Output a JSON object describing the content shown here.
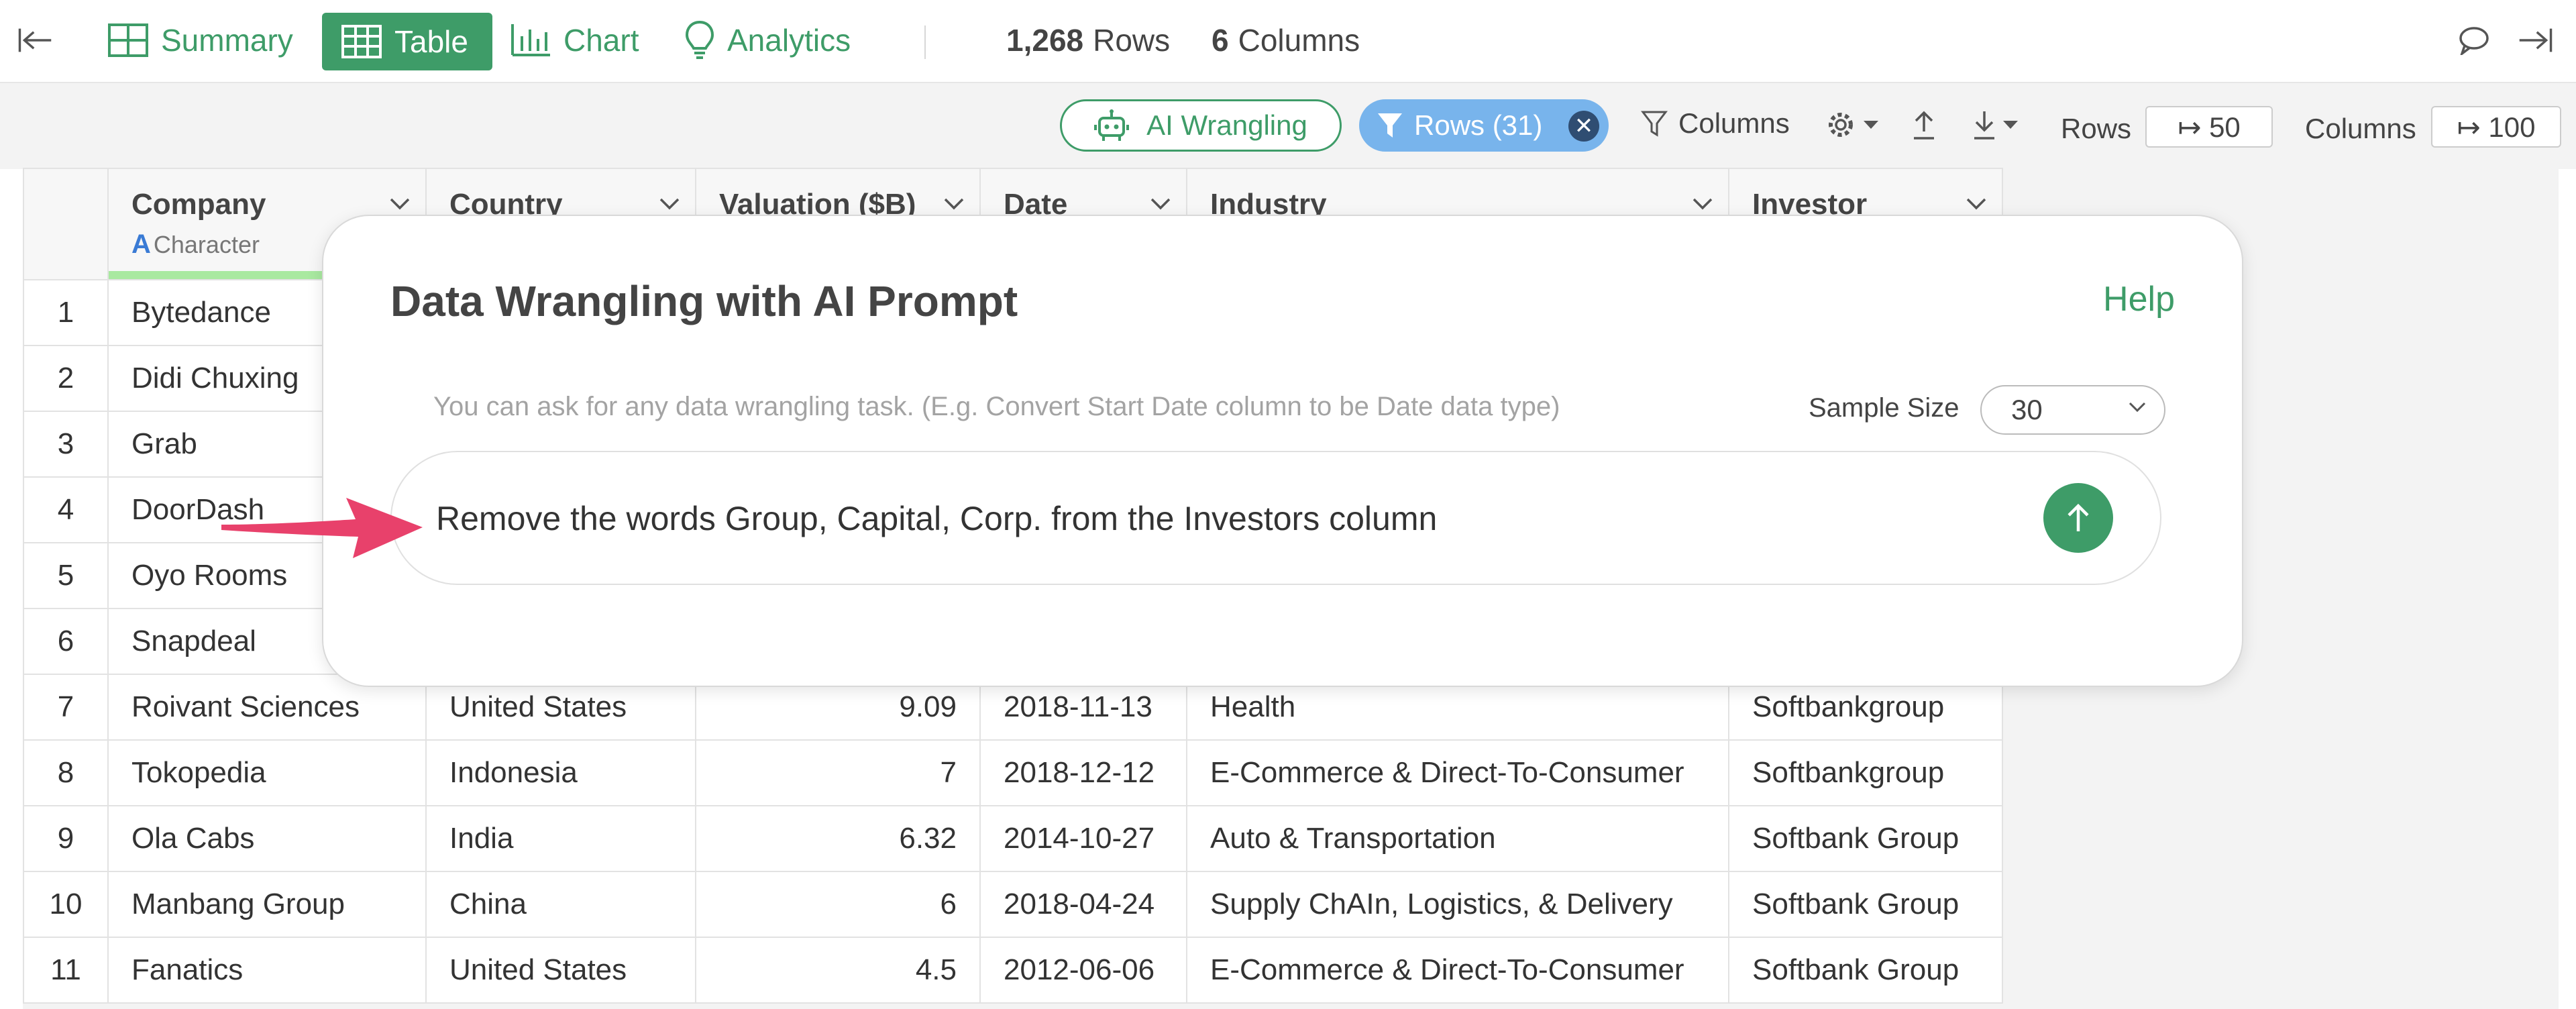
{
  "topbar": {
    "tabs": [
      {
        "label": "Summary",
        "icon": "summary-grid-icon"
      },
      {
        "label": "Table",
        "icon": "table-icon",
        "active": true
      },
      {
        "label": "Chart",
        "icon": "bar-chart-icon"
      },
      {
        "label": "Analytics",
        "icon": "lightbulb-icon"
      }
    ],
    "rows_count": "1,268",
    "rows_word": "Rows",
    "cols_count": "6",
    "cols_word": "Columns"
  },
  "toolbar": {
    "ai_wrangling_label": "AI Wrangling",
    "rows_filter_label": "Rows (31)",
    "columns_label": "Columns",
    "rows_label": "Rows",
    "rows_limit": "↦ 50",
    "cols_label": "Columns",
    "cols_limit": "↦ 100"
  },
  "table": {
    "headers": {
      "company": "Company",
      "company_type": "Character",
      "country": "Country",
      "valuation": "Valuation ($B)",
      "date": "Date",
      "industry": "Industry",
      "investor": "Investor"
    },
    "rows": [
      {
        "n": "1",
        "company": "Bytedance",
        "country": "",
        "valuation": "",
        "date": "",
        "industry": "",
        "investor": ""
      },
      {
        "n": "2",
        "company": "Didi Chuxing",
        "country": "",
        "valuation": "",
        "date": "",
        "industry": "",
        "investor": ""
      },
      {
        "n": "3",
        "company": "Grab",
        "country": "",
        "valuation": "",
        "date": "",
        "industry": "",
        "investor": ""
      },
      {
        "n": "4",
        "company": "DoorDash",
        "country": "",
        "valuation": "",
        "date": "",
        "industry": "",
        "investor": ""
      },
      {
        "n": "5",
        "company": "Oyo Rooms",
        "country": "",
        "valuation": "",
        "date": "",
        "industry": "",
        "investor": ""
      },
      {
        "n": "6",
        "company": "Snapdeal",
        "country": "",
        "valuation": "",
        "date": "",
        "industry": "",
        "investor": ""
      },
      {
        "n": "7",
        "company": "Roivant Sciences",
        "country": "United States",
        "valuation": "9.09",
        "date": "2018-11-13",
        "industry": "Health",
        "investor": "Softbankgroup"
      },
      {
        "n": "8",
        "company": "Tokopedia",
        "country": "Indonesia",
        "valuation": "7",
        "date": "2018-12-12",
        "industry": "E-Commerce & Direct-To-Consumer",
        "investor": "Softbankgroup"
      },
      {
        "n": "9",
        "company": "Ola Cabs",
        "country": "India",
        "valuation": "6.32",
        "date": "2014-10-27",
        "industry": "Auto & Transportation",
        "investor": "Softbank Group"
      },
      {
        "n": "10",
        "company": "Manbang Group",
        "country": "China",
        "valuation": "6",
        "date": "2018-04-24",
        "industry": "Supply ChAIn, Logistics, & Delivery",
        "investor": "Softbank Group"
      },
      {
        "n": "11",
        "company": "Fanatics",
        "country": "United States",
        "valuation": "4.5",
        "date": "2012-06-06",
        "industry": "E-Commerce & Direct-To-Consumer",
        "investor": "Softbank Group"
      }
    ]
  },
  "dialog": {
    "title": "Data Wrangling with AI Prompt",
    "help": "Help",
    "hint": "You can ask for any data wrangling task. (E.g. Convert Start Date column to be Date data type)",
    "sample_label": "Sample Size",
    "sample_value": "30",
    "prompt": "Remove the words Group, Capital, Corp. from the Investors column"
  },
  "colors": {
    "accent_green": "#3e9c68",
    "chip_blue": "#78b4ec",
    "pointer_pink": "#e8416b",
    "type_bar_green": "#a9e9a0"
  }
}
